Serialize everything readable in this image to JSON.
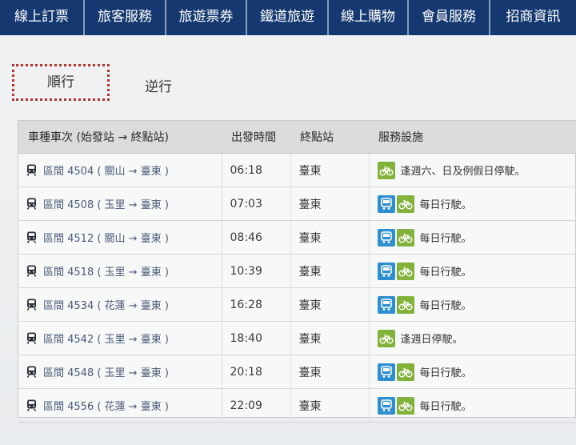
{
  "nav": {
    "items": [
      {
        "label": "線上訂票"
      },
      {
        "label": "旅客服務"
      },
      {
        "label": "旅遊票券"
      },
      {
        "label": "鐵道旅遊"
      },
      {
        "label": "線上購物"
      },
      {
        "label": "會員服務"
      },
      {
        "label": "招商資訊"
      }
    ]
  },
  "tabs": {
    "forward": "順行",
    "reverse": "逆行"
  },
  "table": {
    "headers": {
      "train": "車種車次 (始發站 → 終點站)",
      "departure": "出發時間",
      "terminal": "終點站",
      "services": "服務設施"
    },
    "rows": [
      {
        "train": "區間 4504 ( 關山 → 臺東 )",
        "time": "06:18",
        "dest": "臺東",
        "accessible": false,
        "bike": true,
        "note": "逢週六、日及例假日停駛。"
      },
      {
        "train": "區間 4508 ( 玉里 → 臺東 )",
        "time": "07:03",
        "dest": "臺東",
        "accessible": true,
        "bike": true,
        "note": "每日行駛。"
      },
      {
        "train": "區間 4512 ( 關山 → 臺東 )",
        "time": "08:46",
        "dest": "臺東",
        "accessible": true,
        "bike": true,
        "note": "每日行駛。"
      },
      {
        "train": "區間 4518 ( 玉里 → 臺東 )",
        "time": "10:39",
        "dest": "臺東",
        "accessible": true,
        "bike": true,
        "note": "每日行駛。"
      },
      {
        "train": "區間 4534 ( 花蓮 → 臺東 )",
        "time": "16:28",
        "dest": "臺東",
        "accessible": true,
        "bike": true,
        "note": "每日行駛。"
      },
      {
        "train": "區間 4542 ( 玉里 → 臺東 )",
        "time": "18:40",
        "dest": "臺東",
        "accessible": false,
        "bike": true,
        "note": "逢週日停駛。"
      },
      {
        "train": "區間 4548 ( 玉里 → 臺東 )",
        "time": "20:18",
        "dest": "臺東",
        "accessible": true,
        "bike": true,
        "note": "每日行駛。"
      },
      {
        "train": "區間 4556 ( 花蓮 → 臺東 )",
        "time": "22:09",
        "dest": "臺東",
        "accessible": true,
        "bike": true,
        "note": "每日行駛。"
      }
    ]
  },
  "icons": {
    "train": "train-icon",
    "accessible": "accessible-icon",
    "bike": "bicycle-icon"
  },
  "colors": {
    "nav_bg": "#14386f",
    "accessible": "#2e8fd0",
    "bike": "#83b23a",
    "active_tab_border": "#b2342f"
  }
}
